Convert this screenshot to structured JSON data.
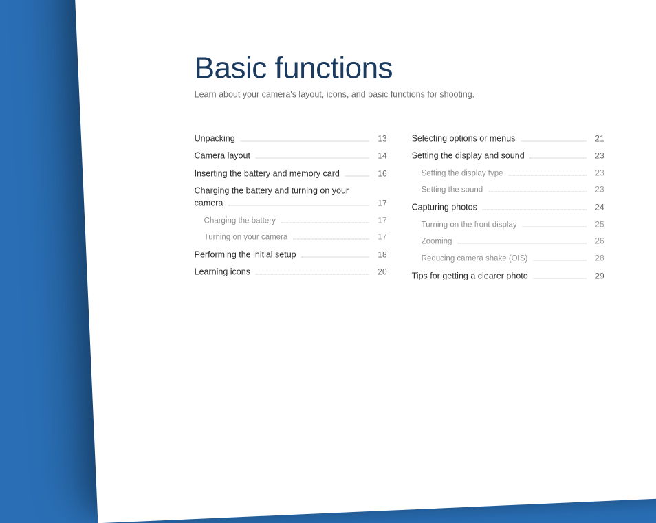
{
  "title": "Basic functions",
  "subtitle": "Learn about your camera's layout, icons, and basic functions for shooting.",
  "left": [
    {
      "label": "Unpacking",
      "page": "13"
    },
    {
      "label": "Camera layout",
      "page": "14"
    },
    {
      "label": "Inserting the battery and memory card",
      "page": "16"
    },
    {
      "label_a": "Charging the battery and turning on your",
      "label_b": "camera",
      "page": "17",
      "wrap": true
    },
    {
      "label": "Charging the battery",
      "page": "17",
      "sub": true
    },
    {
      "label": "Turning on your camera",
      "page": "17",
      "sub": true
    },
    {
      "label": "Performing the initial setup",
      "page": "18"
    },
    {
      "label": "Learning icons",
      "page": "20"
    }
  ],
  "right": [
    {
      "label": "Selecting options or menus",
      "page": "21"
    },
    {
      "label": "Setting the display and sound",
      "page": "23"
    },
    {
      "label": "Setting the display type",
      "page": "23",
      "sub": true
    },
    {
      "label": "Setting the sound",
      "page": "23",
      "sub": true
    },
    {
      "label": "Capturing photos",
      "page": "24"
    },
    {
      "label": "Turning on the front display",
      "page": "25",
      "sub": true
    },
    {
      "label": "Zooming",
      "page": "26",
      "sub": true
    },
    {
      "label": "Reducing camera shake (OIS)",
      "page": "28",
      "sub": true
    },
    {
      "label": "Tips for getting a clearer photo",
      "page": "29"
    }
  ]
}
